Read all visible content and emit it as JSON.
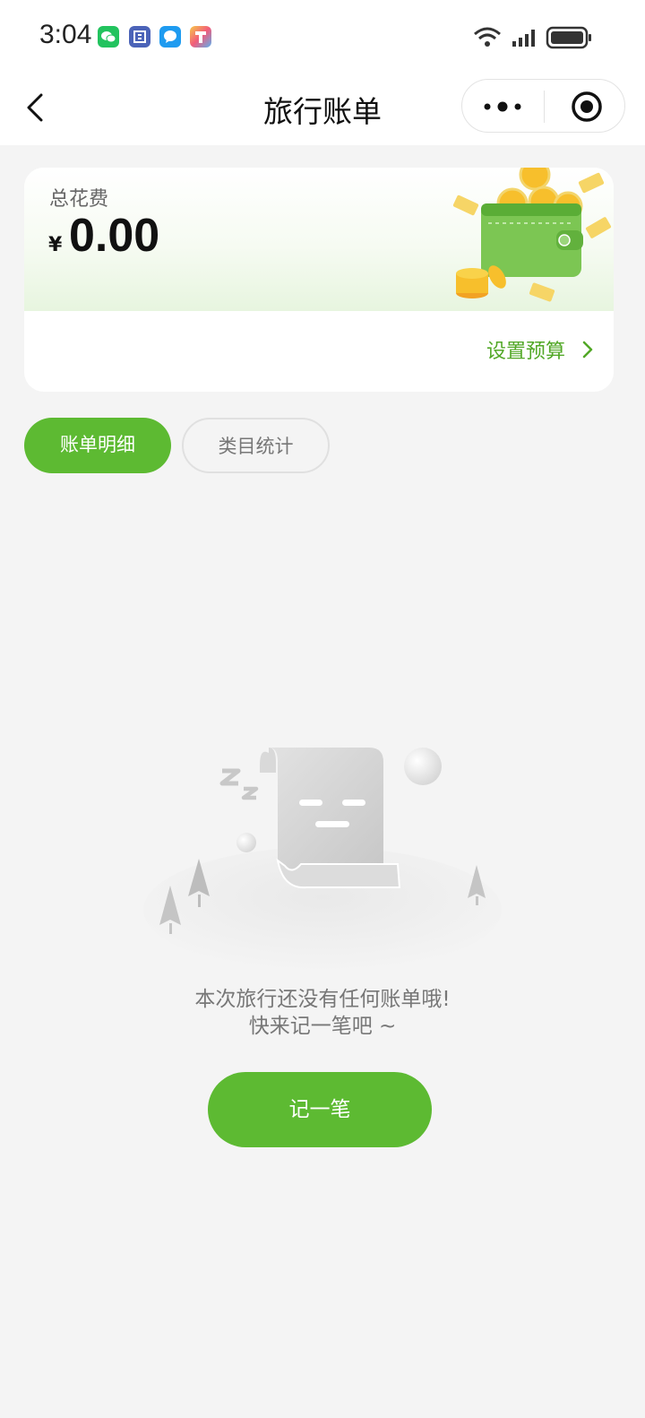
{
  "status_bar": {
    "time": "3:04",
    "app_icons": [
      "wechat-icon",
      "calendar-app-icon",
      "messages-icon",
      "pinned-app-icon"
    ],
    "system_icons": [
      "wifi-icon",
      "signal-icon",
      "battery-icon"
    ]
  },
  "nav": {
    "title": "旅行账单",
    "back_icon": "chevron-left-icon",
    "more_icon": "more-dots-icon",
    "close_icon": "target-close-icon"
  },
  "summary": {
    "label": "总花费",
    "currency": "¥",
    "total": "0.00",
    "budget_label": "设置预算"
  },
  "tabs": [
    {
      "label": "账单明细",
      "active": true
    },
    {
      "label": "类目统计",
      "active": false
    }
  ],
  "empty_state": {
    "line1": "本次旅行还没有任何账单哦!",
    "line2": "快来记一笔吧 ~",
    "button": "记一笔"
  },
  "colors": {
    "accent": "#5dba32",
    "accent_text": "#52a827",
    "background": "#f4f4f4"
  }
}
